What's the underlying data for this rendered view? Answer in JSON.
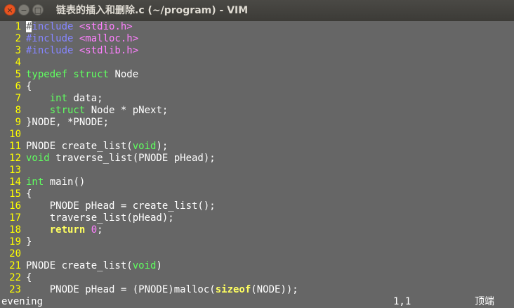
{
  "window": {
    "title": "链表的插入和删除.c (~/program) - VIM",
    "buttons": {
      "close": "×",
      "minimize": "−",
      "maximize": "□"
    }
  },
  "editor": {
    "lines": [
      {
        "num": "1",
        "tokens": [
          [
            "cursor",
            "#"
          ],
          [
            "pre",
            "include "
          ],
          [
            "inc",
            "<stdio.h>"
          ]
        ]
      },
      {
        "num": "2",
        "tokens": [
          [
            "pre",
            "#include "
          ],
          [
            "inc",
            "<malloc.h>"
          ]
        ]
      },
      {
        "num": "3",
        "tokens": [
          [
            "pre",
            "#include "
          ],
          [
            "inc",
            "<stdlib.h>"
          ]
        ]
      },
      {
        "num": "4",
        "tokens": []
      },
      {
        "num": "5",
        "tokens": [
          [
            "ty",
            "typedef struct"
          ],
          [
            "txt",
            " Node"
          ]
        ]
      },
      {
        "num": "6",
        "tokens": [
          [
            "txt",
            "{"
          ]
        ]
      },
      {
        "num": "7",
        "tokens": [
          [
            "txt",
            "    "
          ],
          [
            "ty",
            "int"
          ],
          [
            "txt",
            " data;"
          ]
        ]
      },
      {
        "num": "8",
        "tokens": [
          [
            "txt",
            "    "
          ],
          [
            "ty",
            "struct"
          ],
          [
            "txt",
            " Node * pNext;"
          ]
        ]
      },
      {
        "num": "9",
        "tokens": [
          [
            "txt",
            "}NODE, *PNODE;"
          ]
        ]
      },
      {
        "num": "10",
        "tokens": []
      },
      {
        "num": "11",
        "tokens": [
          [
            "txt",
            "PNODE create_list("
          ],
          [
            "ty",
            "void"
          ],
          [
            "txt",
            ");"
          ]
        ]
      },
      {
        "num": "12",
        "tokens": [
          [
            "ty",
            "void"
          ],
          [
            "txt",
            " traverse_list(PNODE pHead);"
          ]
        ]
      },
      {
        "num": "13",
        "tokens": []
      },
      {
        "num": "14",
        "tokens": [
          [
            "ty",
            "int"
          ],
          [
            "txt",
            " main()"
          ]
        ]
      },
      {
        "num": "15",
        "tokens": [
          [
            "txt",
            "{"
          ]
        ]
      },
      {
        "num": "16",
        "tokens": [
          [
            "txt",
            "    PNODE pHead = create_list();"
          ]
        ]
      },
      {
        "num": "17",
        "tokens": [
          [
            "txt",
            "    traverse_list(pHead);"
          ]
        ]
      },
      {
        "num": "18",
        "tokens": [
          [
            "txt",
            "    "
          ],
          [
            "kwb",
            "return"
          ],
          [
            "txt",
            " "
          ],
          [
            "num",
            "0"
          ],
          [
            "txt",
            ";"
          ]
        ]
      },
      {
        "num": "19",
        "tokens": [
          [
            "txt",
            "}"
          ]
        ]
      },
      {
        "num": "20",
        "tokens": []
      },
      {
        "num": "21",
        "tokens": [
          [
            "txt",
            "PNODE create_list("
          ],
          [
            "ty",
            "void"
          ],
          [
            "txt",
            ")"
          ]
        ]
      },
      {
        "num": "22",
        "tokens": [
          [
            "txt",
            "{"
          ]
        ]
      },
      {
        "num": "23",
        "tokens": [
          [
            "txt",
            "    PNODE pHead = (PNODE)malloc("
          ],
          [
            "kwb",
            "sizeof"
          ],
          [
            "txt",
            "(NODE));"
          ]
        ]
      }
    ]
  },
  "statusline": {
    "colorscheme": "evening",
    "position": "1,1",
    "scroll": "顶端"
  },
  "colors": {
    "background": "#666666",
    "line_number": "#ffff00",
    "preprocessor": "#8585ff",
    "include_string": "#ff80ff",
    "type_keyword": "#60ff60",
    "statement_keyword": "#ffff60",
    "number": "#ff80ff",
    "text": "#ffffff"
  }
}
